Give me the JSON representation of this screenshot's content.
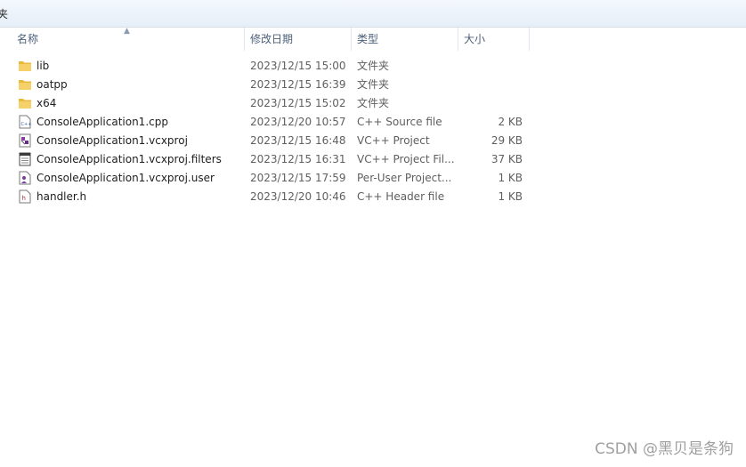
{
  "topstrip": {
    "label": "夹"
  },
  "columns": {
    "name": "名称",
    "date": "修改日期",
    "type": "类型",
    "size": "大小"
  },
  "files": [
    {
      "name": "lib",
      "date": "2023/12/15 15:00",
      "type": "文件夹",
      "size": "",
      "icon": "folder-icon"
    },
    {
      "name": "oatpp",
      "date": "2023/12/15 16:39",
      "type": "文件夹",
      "size": "",
      "icon": "folder-icon"
    },
    {
      "name": "x64",
      "date": "2023/12/15 15:02",
      "type": "文件夹",
      "size": "",
      "icon": "folder-icon"
    },
    {
      "name": "ConsoleApplication1.cpp",
      "date": "2023/12/20 10:57",
      "type": "C++ Source file",
      "size": "2 KB",
      "icon": "cpp-file-icon"
    },
    {
      "name": "ConsoleApplication1.vcxproj",
      "date": "2023/12/15 16:48",
      "type": "VC++ Project",
      "size": "29 KB",
      "icon": "vcxproj-file-icon"
    },
    {
      "name": "ConsoleApplication1.vcxproj.filters",
      "date": "2023/12/15 16:31",
      "type": "VC++ Project Fil...",
      "size": "37 KB",
      "icon": "filters-file-icon"
    },
    {
      "name": "ConsoleApplication1.vcxproj.user",
      "date": "2023/12/15 17:59",
      "type": "Per-User Project...",
      "size": "1 KB",
      "icon": "user-file-icon"
    },
    {
      "name": "handler.h",
      "date": "2023/12/20 10:46",
      "type": "C++ Header file",
      "size": "1 KB",
      "icon": "header-file-icon"
    }
  ],
  "watermark": "CSDN @黑贝是条狗",
  "colors": {
    "folder": "#e8b93a",
    "header_text": "#4c607a",
    "meta_text": "#5f5f5f"
  }
}
